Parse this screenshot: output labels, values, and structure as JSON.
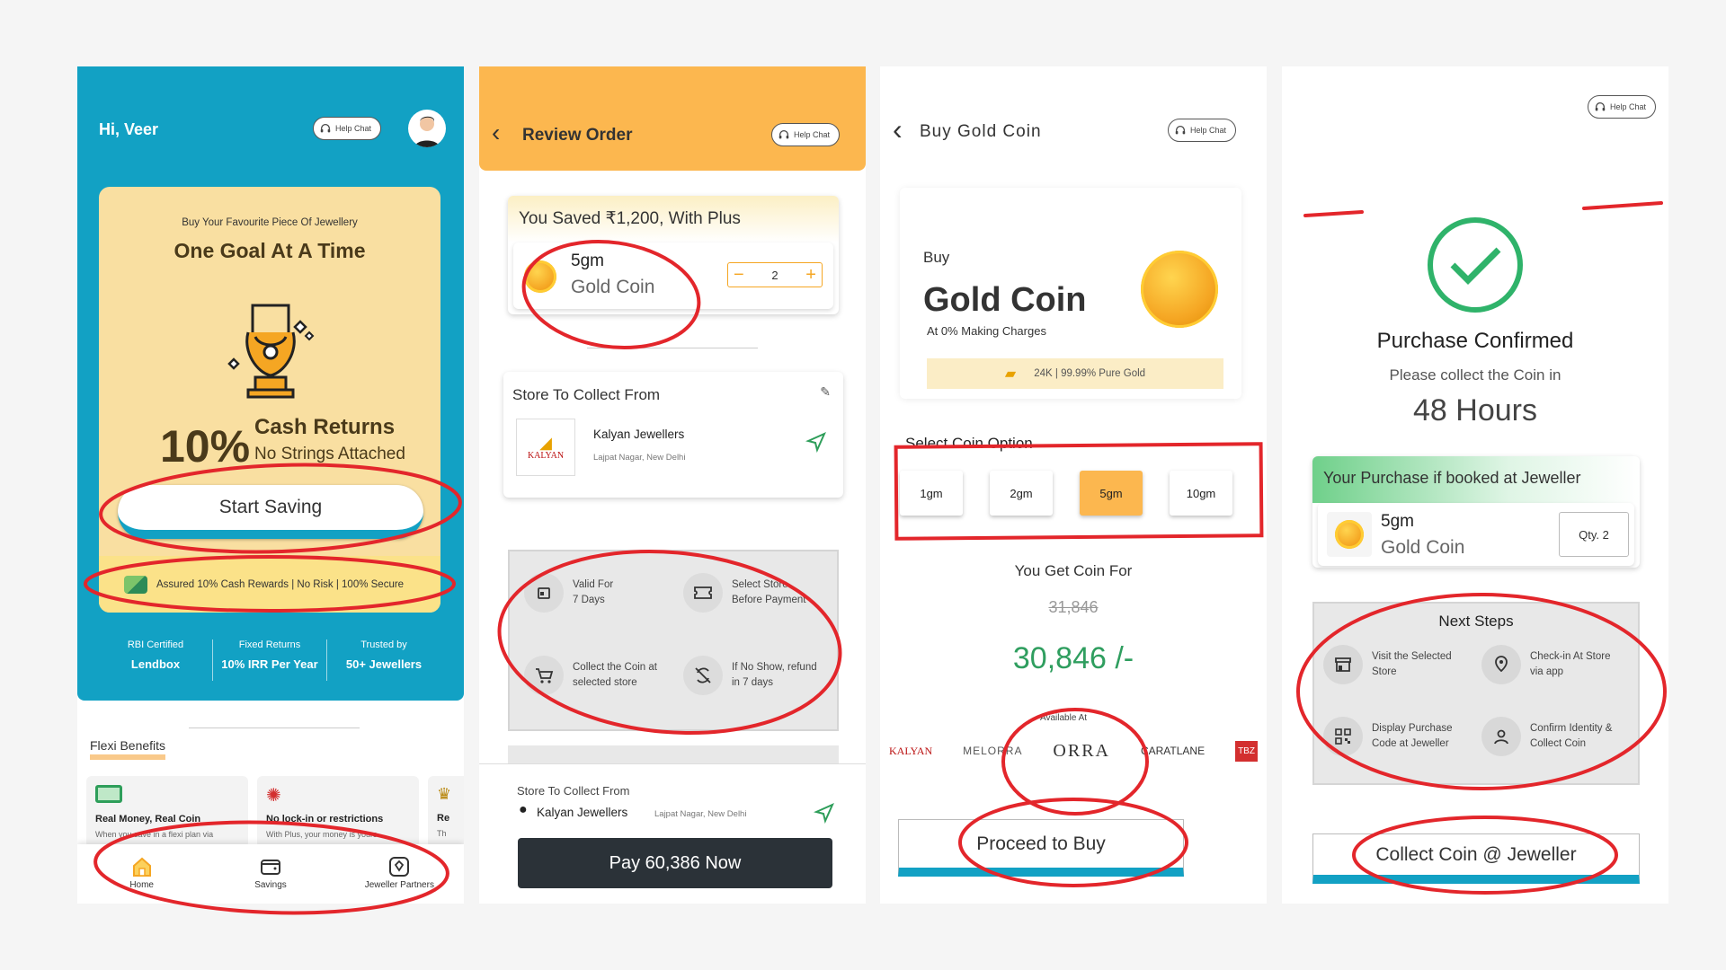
{
  "screen1": {
    "greeting": "Hi, Veer",
    "help_chat": "Help Chat",
    "promo": {
      "subtitle": "Buy Your Favourite Piece Of Jewellery",
      "title": "One Goal At A Time",
      "percent": "10%",
      "cash_returns": "Cash Returns",
      "no_strings": "No Strings Attached",
      "cta": "Start Saving",
      "assurance": "Assured 10% Cash Rewards | No Risk | 100% Secure"
    },
    "stats": [
      {
        "label": "RBI Certified",
        "value": "Lendbox"
      },
      {
        "label": "Fixed Returns",
        "value": "10% IRR Per Year"
      },
      {
        "label": "Trusted by",
        "value": "50+ Jewellers"
      }
    ],
    "flexi_title": "Flexi Benefits",
    "benefits": [
      {
        "title": "Real Money, Real Coin",
        "desc": "When you save in a flexi plan via"
      },
      {
        "title": "No lock-in or restrictions",
        "desc": "With Plus, your money is yours"
      },
      {
        "title": "Re",
        "desc": "Th"
      }
    ],
    "nav": [
      {
        "label": "Home",
        "icon": "home-icon"
      },
      {
        "label": "Savings",
        "icon": "wallet-icon"
      },
      {
        "label": "Jeweller Partners",
        "icon": "shop-icon"
      }
    ],
    "colors": {
      "teal": "#12a1c4",
      "cream": "#f9dfa1",
      "accent": "#f5a623"
    }
  },
  "screen2": {
    "title": "Review Order",
    "help_chat": "Help Chat",
    "saved": "You Saved ₹1,200, With Plus",
    "weight": "5gm",
    "item": "Gold Coin",
    "qty": "2",
    "store_section": "Store To Collect From",
    "store_name": "Kalyan Jewellers",
    "store_location": "Lajpat Nagar, New Delhi",
    "store_logo": "KALYAN",
    "info": [
      {
        "text": "Valid For\n7 Days",
        "icon": "calendar-icon"
      },
      {
        "text": "Select Store\nBefore Payment",
        "icon": "ticket-icon"
      },
      {
        "text": "Collect the Coin at\nselected store",
        "icon": "cart-icon"
      },
      {
        "text": "If No Show, refund\nin 7 days",
        "icon": "no-refresh-icon"
      }
    ],
    "footer_label": "Store To Collect From",
    "footer_store": "Kalyan Jewellers",
    "footer_location": "Lajpat Nagar, New Delhi",
    "pay_button": "Pay 60,386 Now",
    "colors": {
      "header": "#fcb74f"
    }
  },
  "screen3": {
    "title": "Buy Gold Coin",
    "help_chat": "Help Chat",
    "buy": "Buy",
    "product": "Gold Coin",
    "making": "At 0% Making Charges",
    "purity": "24K | 99.99% Pure Gold",
    "select_label": "Select Coin Option",
    "options": [
      "1gm",
      "2gm",
      "5gm",
      "10gm"
    ],
    "selected_option": "5gm",
    "get_for": "You Get Coin For",
    "old_price": "31,846",
    "price": "30,846 /-",
    "available_at": "Available At",
    "partners": [
      "KALYAN",
      "MELORRA",
      "ORRA",
      "CARATLANE",
      "TBZ"
    ],
    "cta": "Proceed to Buy",
    "colors": {
      "green": "#2f9e5f",
      "selected": "#fcb74f"
    }
  },
  "screen4": {
    "help_chat": "Help Chat",
    "confirmed": "Purchase Confirmed",
    "collect_in": "Please collect the Coin in",
    "hours": "48 Hours",
    "booked": "Your Purchase if booked at Jeweller",
    "weight": "5gm",
    "item": "Gold Coin",
    "qty": "Qty. 2",
    "next_steps": "Next Steps",
    "steps": [
      {
        "text": "Visit the Selected\nStore",
        "icon": "store-icon"
      },
      {
        "text": "Check-in At Store\nvia app",
        "icon": "location-icon"
      },
      {
        "text": "Display Purchase\nCode at Jeweller",
        "icon": "qr-icon"
      },
      {
        "text": "Confirm Identity &\nCollect Coin",
        "icon": "user-icon"
      }
    ],
    "cta": "Collect Coin @ Jeweller",
    "colors": {
      "check": "#2fb36a"
    }
  }
}
